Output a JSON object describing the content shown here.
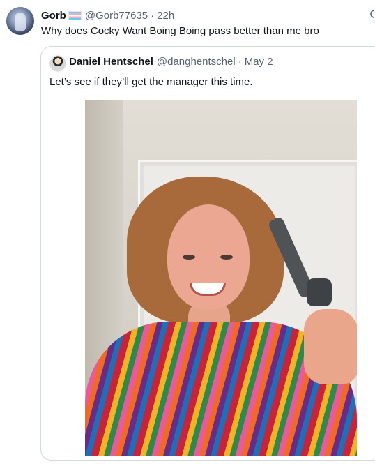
{
  "tweet": {
    "author_name": "Gorb",
    "author_handle": "@Gorb77635",
    "separator": "·",
    "time": "22h",
    "text": "Why does Cocky Want Boing Boing pass better than me bro"
  },
  "quoted_tweet": {
    "author_name": "Daniel Hentschel",
    "author_handle": "@danghentschel",
    "separator": "·",
    "date": "May 2",
    "text": "Let’s see if they’ll get the manager this time."
  },
  "icons": {
    "avatar": "profile-avatar-icon",
    "flag": "transgender-flag-icon",
    "quoted_avatar": "profile-avatar-icon",
    "top_right": "grok-icon"
  },
  "colors": {
    "text_primary": "#0f1419",
    "text_secondary": "#536471",
    "border": "#cfd9de"
  }
}
